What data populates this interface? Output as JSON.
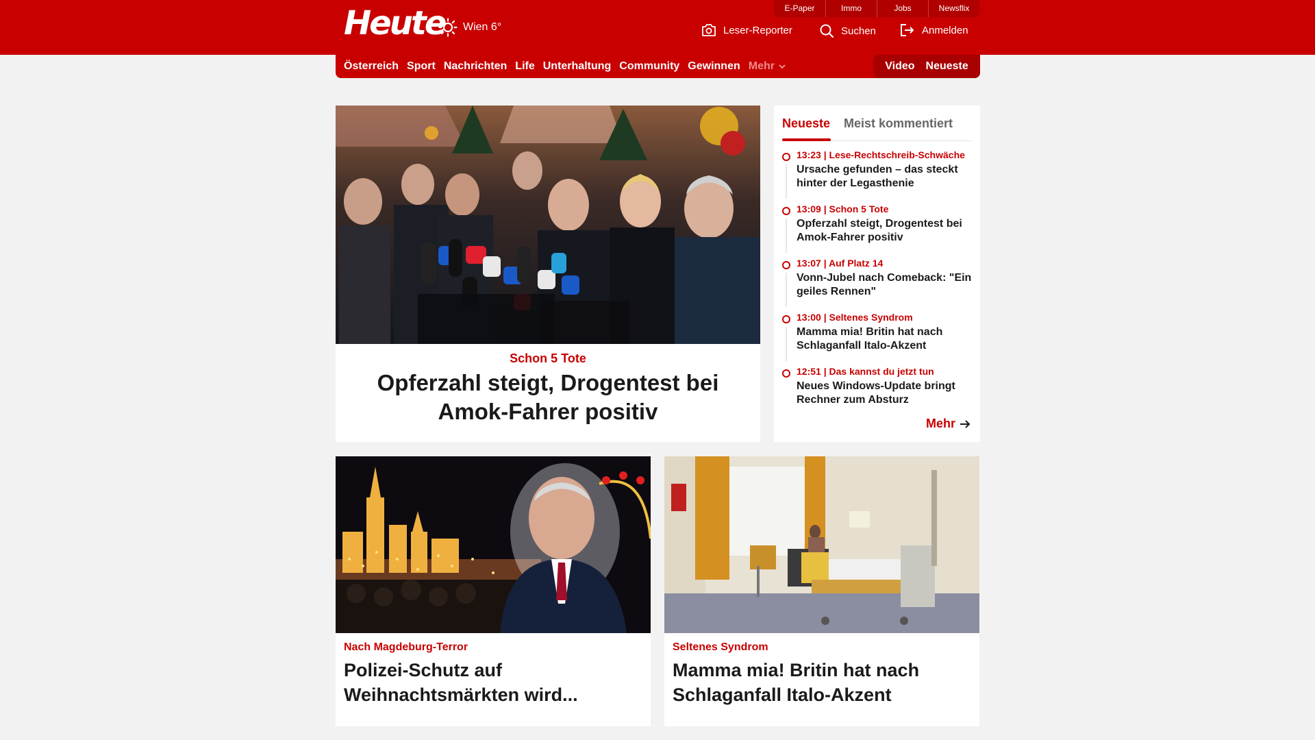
{
  "header": {
    "logo": "Heute",
    "weather": "Wien 6°",
    "top_links": [
      "E-Paper",
      "Immo",
      "Jobs",
      "Newsflix"
    ],
    "actions": {
      "reporter": "Leser-Reporter",
      "search": "Suchen",
      "login": "Anmelden"
    }
  },
  "nav": {
    "items": [
      "Österreich",
      "Sport",
      "Nachrichten",
      "Life",
      "Unterhaltung",
      "Community",
      "Gewinnen"
    ],
    "more": "Mehr",
    "video": "Video",
    "latest": "Neueste"
  },
  "hero": {
    "kicker": "Schon 5 Tote",
    "title": "Opferzahl steigt, Drogentest bei Amok-Fahrer positiv"
  },
  "sidebar": {
    "tabs": [
      "Neueste",
      "Meist kommentiert"
    ],
    "items": [
      {
        "meta": "13:23 | Lese-Rechtschreib-Schwäche",
        "title": "Ursache gefunden – das steckt hinter der Legasthenie"
      },
      {
        "meta": "13:09 | Schon 5 Tote",
        "title": "Opferzahl steigt, Drogentest bei Amok-Fahrer positiv"
      },
      {
        "meta": "13:07 | Auf Platz 14",
        "title": "Vonn-Jubel nach Comeback: \"Ein geiles Rennen\""
      },
      {
        "meta": "13:00 | Seltenes Syndrom",
        "title": "Mamma mia! Britin hat nach Schlaganfall Italo-Akzent"
      },
      {
        "meta": "12:51 | Das kannst du jetzt tun",
        "title": "Neues Windows-Update bringt Rechner zum Absturz"
      }
    ],
    "more": "Mehr"
  },
  "cards": [
    {
      "kicker": "Nach Magdeburg-Terror",
      "title": "Polizei-Schutz auf Weihnachtsmärkten wird..."
    },
    {
      "kicker": "Seltenes Syndrom",
      "title": "Mamma mia! Britin hat nach Schlaganfall Italo-Akzent"
    }
  ],
  "colors": {
    "brand": "#c80000",
    "brand_dark": "#a80000",
    "background": "#f2f2f2"
  }
}
